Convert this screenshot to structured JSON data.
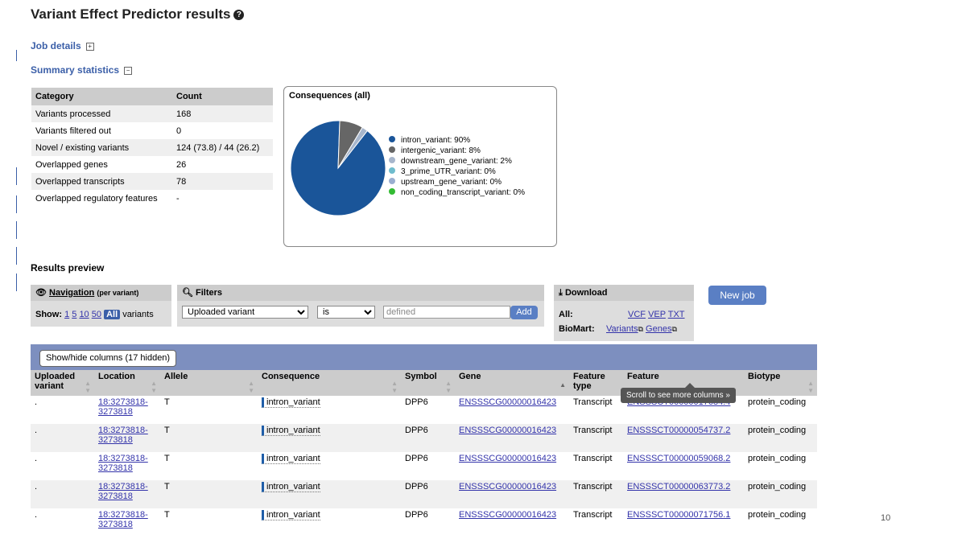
{
  "page": {
    "title": "Variant Effect Predictor results",
    "job_details": "Job details",
    "summary_statistics": "Summary statistics",
    "results_preview": "Results preview",
    "page_number": "10"
  },
  "summary": {
    "headers": [
      "Category",
      "Count"
    ],
    "rows": [
      [
        "Variants processed",
        "168"
      ],
      [
        "Variants filtered out",
        "0"
      ],
      [
        "Novel / existing variants",
        "124 (73.8) / 44 (26.2)"
      ],
      [
        "Overlapped genes",
        "26"
      ],
      [
        "Overlapped transcripts",
        "78"
      ],
      [
        "Overlapped regulatory features",
        "-"
      ]
    ]
  },
  "chart_data": {
    "type": "pie",
    "title": "Consequences (all)",
    "labels": [
      "intron_variant: 90%",
      "intergenic_variant: 8%",
      "downstream_gene_variant: 2%",
      "3_prime_UTR_variant: 0%",
      "upstream_gene_variant: 0%",
      "non_coding_transcript_variant: 0%"
    ],
    "categories": [
      "intron_variant",
      "intergenic_variant",
      "downstream_gene_variant",
      "3_prime_UTR_variant",
      "upstream_gene_variant",
      "non_coding_transcript_variant"
    ],
    "values": [
      90,
      8,
      2,
      0,
      0,
      0
    ],
    "colors": [
      "#1a5599",
      "#666666",
      "#a7b6cc",
      "#6fbccd",
      "#9aaed0",
      "#33bb33"
    ]
  },
  "navigation": {
    "title": "Navigation",
    "subtitle": "(per variant)",
    "show_label": "Show:",
    "options": [
      "1",
      "5",
      "10",
      "50"
    ],
    "all_label": "All",
    "variants_label": "variants"
  },
  "filters": {
    "title": "Filters",
    "field_value": "Uploaded variant",
    "operator_value": "is",
    "value_placeholder": "defined",
    "add_label": "Add"
  },
  "download": {
    "title": "Download",
    "all_label": "All:",
    "formats": [
      "VCF",
      "VEP",
      "TXT"
    ],
    "biomart_label": "BioMart:",
    "biomart_links": [
      "Variants",
      "Genes"
    ]
  },
  "new_job_label": "New job",
  "results": {
    "show_hide_label": "Show/hide columns (17 hidden)",
    "tooltip": "Scroll to see more columns »",
    "columns": [
      "Uploaded variant",
      "Location",
      "Allele",
      "Consequence",
      "Symbol",
      "Gene",
      "Feature type",
      "Feature",
      "Biotype"
    ],
    "rows": [
      {
        "uploaded": ".",
        "location": "18:3273818-3273818",
        "allele": "T",
        "consequence": "intron_variant",
        "symbol": "DPP6",
        "gene": "ENSSSCG00000016423",
        "feature_type": "Transcript",
        "feature": "ENSSSCT00000017684.4",
        "biotype": "protein_coding"
      },
      {
        "uploaded": ".",
        "location": "18:3273818-3273818",
        "allele": "T",
        "consequence": "intron_variant",
        "symbol": "DPP6",
        "gene": "ENSSSCG00000016423",
        "feature_type": "Transcript",
        "feature": "ENSSSCT00000054737.2",
        "biotype": "protein_coding"
      },
      {
        "uploaded": ".",
        "location": "18:3273818-3273818",
        "allele": "T",
        "consequence": "intron_variant",
        "symbol": "DPP6",
        "gene": "ENSSSCG00000016423",
        "feature_type": "Transcript",
        "feature": "ENSSSCT00000059068.2",
        "biotype": "protein_coding"
      },
      {
        "uploaded": ".",
        "location": "18:3273818-3273818",
        "allele": "T",
        "consequence": "intron_variant",
        "symbol": "DPP6",
        "gene": "ENSSSCG00000016423",
        "feature_type": "Transcript",
        "feature": "ENSSSCT00000063773.2",
        "biotype": "protein_coding"
      },
      {
        "uploaded": ".",
        "location": "18:3273818-3273818",
        "allele": "T",
        "consequence": "intron_variant",
        "symbol": "DPP6",
        "gene": "ENSSSCG00000016423",
        "feature_type": "Transcript",
        "feature": "ENSSSCT00000071756.1",
        "biotype": "protein_coding"
      }
    ]
  }
}
